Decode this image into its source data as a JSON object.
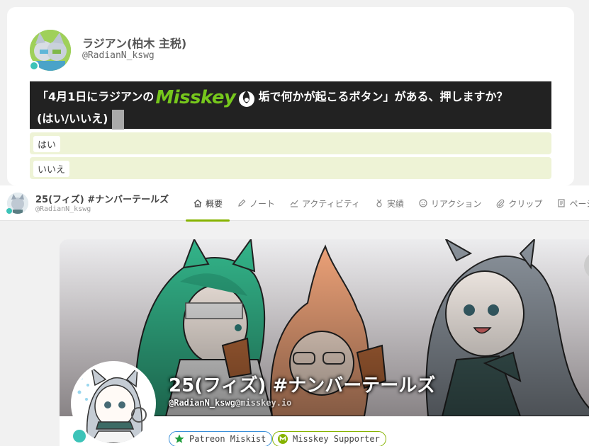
{
  "note": {
    "author_name": "ラジアン(柏木 主税)",
    "author_acct": "@RadianN_kswg",
    "text_before_emoji": "「4月1日にラジアンの",
    "emoji_text": "Misskey",
    "text_after_emoji": "垢で何かが起こるボタン」がある、押しますか？",
    "text_line2": "(はい/いいえ)",
    "choices": [
      "はい",
      "いいえ"
    ]
  },
  "profile_bar": {
    "name": "25(フィズ) #ナンバーテールズ",
    "acct": "@RadianN_kswg",
    "tabs": [
      {
        "label": "概要",
        "icon": "home-icon"
      },
      {
        "label": "ノート",
        "icon": "pencil-icon"
      },
      {
        "label": "アクティビティ",
        "icon": "chart-line-icon"
      },
      {
        "label": "実績",
        "icon": "medal-icon"
      },
      {
        "label": "リアクション",
        "icon": "mood-smile-icon"
      },
      {
        "label": "クリップ",
        "icon": "paperclip-icon"
      },
      {
        "label": "ページ",
        "icon": "page-icon"
      }
    ],
    "active_tab": "概要"
  },
  "profile": {
    "display_name": "25(フィズ) #ナンバーテールズ",
    "acct_user": "@RadianN_kswg",
    "acct_host": "@misskey.io",
    "badges": [
      {
        "label": "Patreon Miskist",
        "icon": "star-icon",
        "color": "#3a8fd8"
      },
      {
        "label": "Misskey Supporter",
        "icon": "supporter-icon",
        "color": "#86b300"
      }
    ]
  },
  "colors": {
    "accent": "#86b300",
    "online": "#3cc3b8",
    "choice_bg": "#eef3d6"
  }
}
